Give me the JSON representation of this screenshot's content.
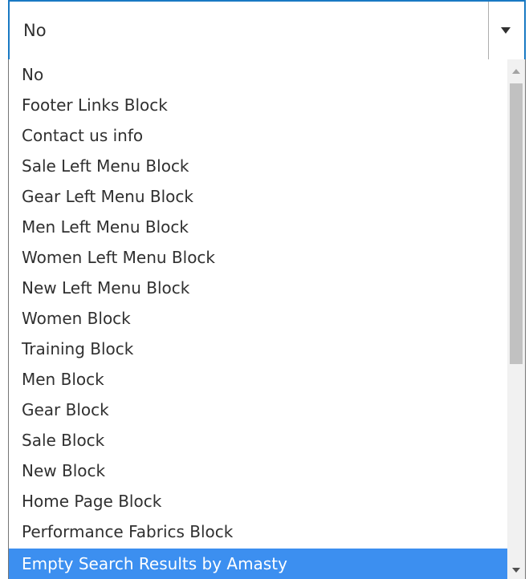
{
  "select": {
    "value": "No",
    "arrow_icon": "chevron-down-icon"
  },
  "options": [
    {
      "label": "No",
      "selected": false
    },
    {
      "label": "Footer Links Block",
      "selected": false
    },
    {
      "label": "Contact us info",
      "selected": false
    },
    {
      "label": "Sale Left Menu Block",
      "selected": false
    },
    {
      "label": "Gear Left Menu Block",
      "selected": false
    },
    {
      "label": "Men Left Menu Block",
      "selected": false
    },
    {
      "label": "Women Left Menu Block",
      "selected": false
    },
    {
      "label": "New Left Menu Block",
      "selected": false
    },
    {
      "label": "Women Block",
      "selected": false
    },
    {
      "label": "Training Block",
      "selected": false
    },
    {
      "label": "Men Block",
      "selected": false
    },
    {
      "label": "Gear Block",
      "selected": false
    },
    {
      "label": "Sale Block",
      "selected": false
    },
    {
      "label": "New Block",
      "selected": false
    },
    {
      "label": "Home Page Block",
      "selected": false
    },
    {
      "label": "Performance Fabrics Block",
      "selected": false
    },
    {
      "label": "Empty Search Results by Amasty",
      "selected": true
    }
  ],
  "colors": {
    "focus_border": "#1979c3",
    "highlight": "#3c8ff0",
    "text": "#303030"
  }
}
